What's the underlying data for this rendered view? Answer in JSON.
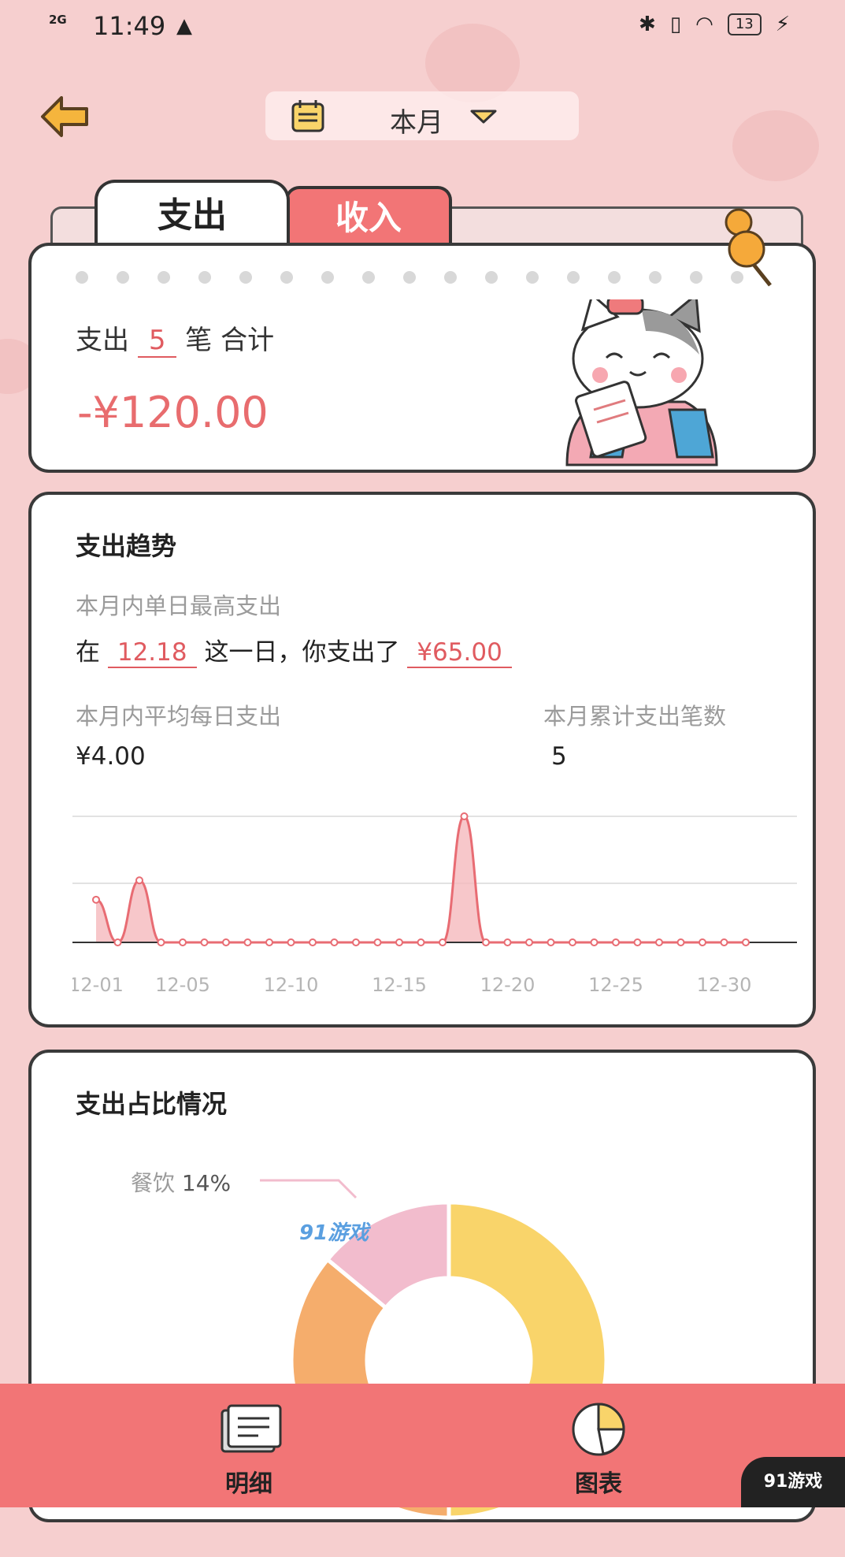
{
  "status_bar": {
    "network": "2G",
    "time": "11:49",
    "battery": "13"
  },
  "header": {
    "period_label": "本月",
    "icons": [
      "back-arrow-icon",
      "calendar-icon",
      "caret-down-icon"
    ]
  },
  "tabs": {
    "expense": "支出",
    "income": "收入",
    "active": "expense"
  },
  "summary": {
    "prefix": "支出",
    "count": "5",
    "suffix": "笔 合计",
    "total": "-¥120.00"
  },
  "trend": {
    "title": "支出趋势",
    "max_label": "本月内单日最高支出",
    "max_prefix": "在",
    "max_date": "12.18",
    "max_middle": "这一日，你支出了",
    "max_amount": "¥65.00",
    "avg_label": "本月内平均每日支出",
    "avg_value": "¥4.00",
    "count_label": "本月累计支出笔数",
    "count_value": "5"
  },
  "chart_data": {
    "type": "area",
    "x": [
      "12-01",
      "12-02",
      "12-03",
      "12-04",
      "12-05",
      "12-06",
      "12-07",
      "12-08",
      "12-09",
      "12-10",
      "12-11",
      "12-12",
      "12-13",
      "12-14",
      "12-15",
      "12-16",
      "12-17",
      "12-18",
      "12-19",
      "12-20",
      "12-21",
      "12-22",
      "12-23",
      "12-24",
      "12-25",
      "12-26",
      "12-27",
      "12-28",
      "12-29",
      "12-30",
      "12-31"
    ],
    "values": [
      22,
      0,
      32,
      0,
      0,
      0,
      0,
      0,
      0,
      0,
      0,
      0,
      0,
      0,
      0,
      0,
      0,
      65,
      0,
      0,
      0,
      0,
      0,
      0,
      0,
      0,
      0,
      0,
      0,
      0,
      0
    ],
    "tick_labels": [
      "12-01",
      "12-05",
      "12-10",
      "12-15",
      "12-20",
      "12-25",
      "12-30"
    ],
    "ylim": [
      0,
      65
    ],
    "grid": true,
    "colors": {
      "line": "#e86c73",
      "fill": "#f5b9bd"
    }
  },
  "share": {
    "title": "支出占比情况",
    "legend_label": "餐饮",
    "legend_pct": "14%",
    "watermark": "91游戏",
    "slices": [
      {
        "pct": 14,
        "color": "#f2bccd"
      },
      {
        "pct": 50,
        "color": "#f9d46a"
      },
      {
        "pct": 36,
        "color": "#f5ad6c"
      }
    ]
  },
  "bottom_nav": {
    "detail": "明细",
    "chart": "图表",
    "badge": "91游戏"
  },
  "colors": {
    "accent": "#f27576",
    "background": "#f6cfcf",
    "highlight": "#f8d77a"
  }
}
